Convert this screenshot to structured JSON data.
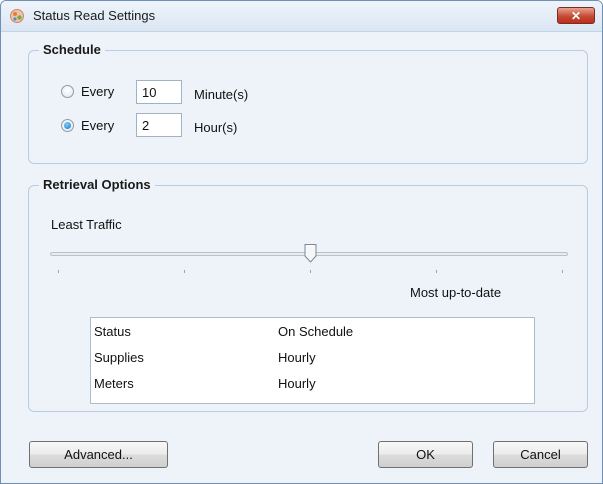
{
  "window": {
    "title": "Status Read Settings",
    "close_glyph": "✕",
    "icon": "status-app-icon"
  },
  "schedule": {
    "legend": "Schedule",
    "options": [
      {
        "label": "Every",
        "value": "10",
        "unit": "Minute(s)",
        "selected": false
      },
      {
        "label": "Every",
        "value": "2",
        "unit": "Hour(s)",
        "selected": true
      }
    ]
  },
  "retrieval": {
    "legend": "Retrieval Options",
    "slider": {
      "min_label": "Least Traffic",
      "max_label": "Most up-to-date",
      "value_fraction": 0.5,
      "tick_count": 5
    },
    "info": [
      {
        "name": "Status",
        "value": "On Schedule"
      },
      {
        "name": "Supplies",
        "value": "Hourly"
      },
      {
        "name": "Meters",
        "value": "Hourly"
      }
    ]
  },
  "buttons": {
    "advanced": "Advanced...",
    "ok": "OK",
    "cancel": "Cancel"
  },
  "colors": {
    "accent": "#1a6fbf",
    "close": "#c74a35",
    "group_border": "#b6cde3"
  }
}
